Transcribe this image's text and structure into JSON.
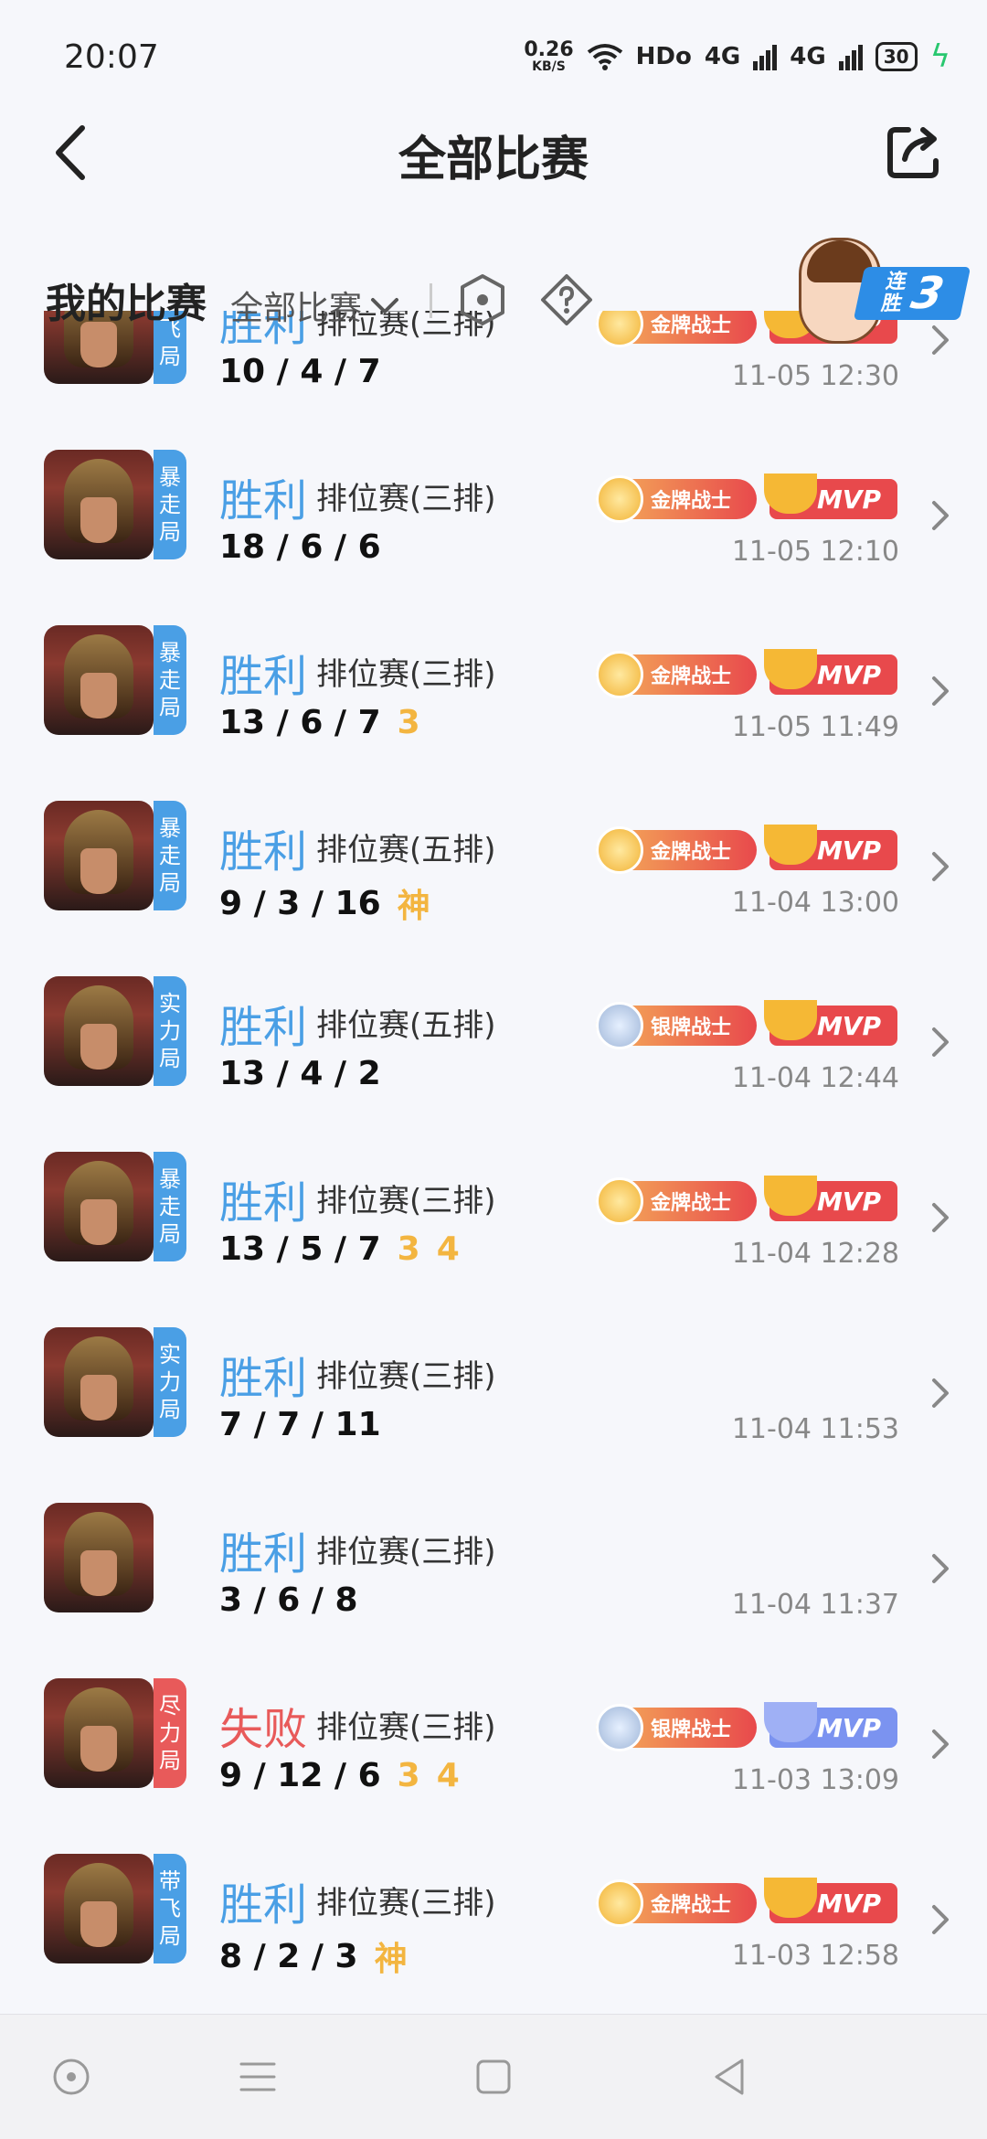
{
  "status_bar": {
    "time": "20:07",
    "net_speed": "0.26",
    "net_unit": "KB/S",
    "hd": "HDo",
    "sig1": "4G",
    "sig2": "4G",
    "battery": "30"
  },
  "header": {
    "title": "全部比赛"
  },
  "filter": {
    "my_matches": "我的比赛",
    "dropdown": "全部比赛",
    "streak_label": "连胜",
    "streak_count": "3"
  },
  "matches": [
    {
      "mode": "带飞局",
      "mode_color": "#4a9fe5",
      "result": "胜利",
      "result_color": "#4a9fe5",
      "queue": "排位赛(三排)",
      "kda": "10 / 4 / 7",
      "highlights": [],
      "medal": "金牌战士",
      "mvp": "MVP",
      "time": "11-05 12:30"
    },
    {
      "mode": "暴走局",
      "mode_color": "#4a9fe5",
      "result": "胜利",
      "result_color": "#4a9fe5",
      "queue": "排位赛(三排)",
      "kda": "18 / 6 / 6",
      "highlights": [],
      "medal": "金牌战士",
      "mvp": "MVP",
      "time": "11-05 12:10"
    },
    {
      "mode": "暴走局",
      "mode_color": "#4a9fe5",
      "result": "胜利",
      "result_color": "#4a9fe5",
      "queue": "排位赛(三排)",
      "kda": "13 / 6 / 7",
      "highlights": [
        "3"
      ],
      "medal": "金牌战士",
      "mvp": "MVP",
      "time": "11-05 11:49"
    },
    {
      "mode": "暴走局",
      "mode_color": "#4a9fe5",
      "result": "胜利",
      "result_color": "#4a9fe5",
      "queue": "排位赛(五排)",
      "kda": "9 / 3 / 16",
      "highlights": [
        "神"
      ],
      "medal": "金牌战士",
      "mvp": "MVP",
      "time": "11-04 13:00"
    },
    {
      "mode": "实力局",
      "mode_color": "#4a9fe5",
      "result": "胜利",
      "result_color": "#4a9fe5",
      "queue": "排位赛(五排)",
      "kda": "13 / 4 / 2",
      "highlights": [],
      "medal": "银牌战士",
      "mvp": "MVP",
      "time": "11-04 12:44"
    },
    {
      "mode": "暴走局",
      "mode_color": "#4a9fe5",
      "result": "胜利",
      "result_color": "#4a9fe5",
      "queue": "排位赛(三排)",
      "kda": "13 / 5 / 7",
      "highlights": [
        "3",
        "4"
      ],
      "medal": "金牌战士",
      "mvp": "MVP",
      "time": "11-04 12:28"
    },
    {
      "mode": "实力局",
      "mode_color": "#4a9fe5",
      "result": "胜利",
      "result_color": "#4a9fe5",
      "queue": "排位赛(三排)",
      "kda": "7 / 7 / 11",
      "highlights": [],
      "medal": "",
      "mvp": "",
      "time": "11-04 11:53"
    },
    {
      "mode": "",
      "mode_color": "",
      "result": "胜利",
      "result_color": "#4a9fe5",
      "queue": "排位赛(三排)",
      "kda": "3 / 6 / 8",
      "highlights": [],
      "medal": "",
      "mvp": "",
      "time": "11-04 11:37"
    },
    {
      "mode": "尽力局",
      "mode_color": "#e85a5a",
      "result": "失败",
      "result_color": "#e85a5a",
      "queue": "排位赛(三排)",
      "kda": "9 / 12 / 6",
      "highlights": [
        "3",
        "4"
      ],
      "medal": "银牌战士",
      "mvp": "MVP",
      "mvp_lose": true,
      "time": "11-03 13:09"
    },
    {
      "mode": "带飞局",
      "mode_color": "#4a9fe5",
      "result": "胜利",
      "result_color": "#4a9fe5",
      "queue": "排位赛(三排)",
      "kda": "8 / 2 / 3",
      "highlights": [
        "神"
      ],
      "medal": "金牌战士",
      "mvp": "MVP",
      "time": "11-03 12:58"
    }
  ],
  "colors": {
    "win": "#4a9fe5",
    "lose": "#e85a5a",
    "gold_medal": "#e8494c",
    "silver_medal": "#e8494c",
    "mvp_win": "#e8494c",
    "mvp_lose": "#7b93f0",
    "highlight": "#f3b540"
  },
  "icons": {
    "back": "chevron-left-icon",
    "share": "share-icon",
    "filter": "hexagon-icon",
    "help": "question-icon",
    "row": "chevron-right-icon"
  }
}
